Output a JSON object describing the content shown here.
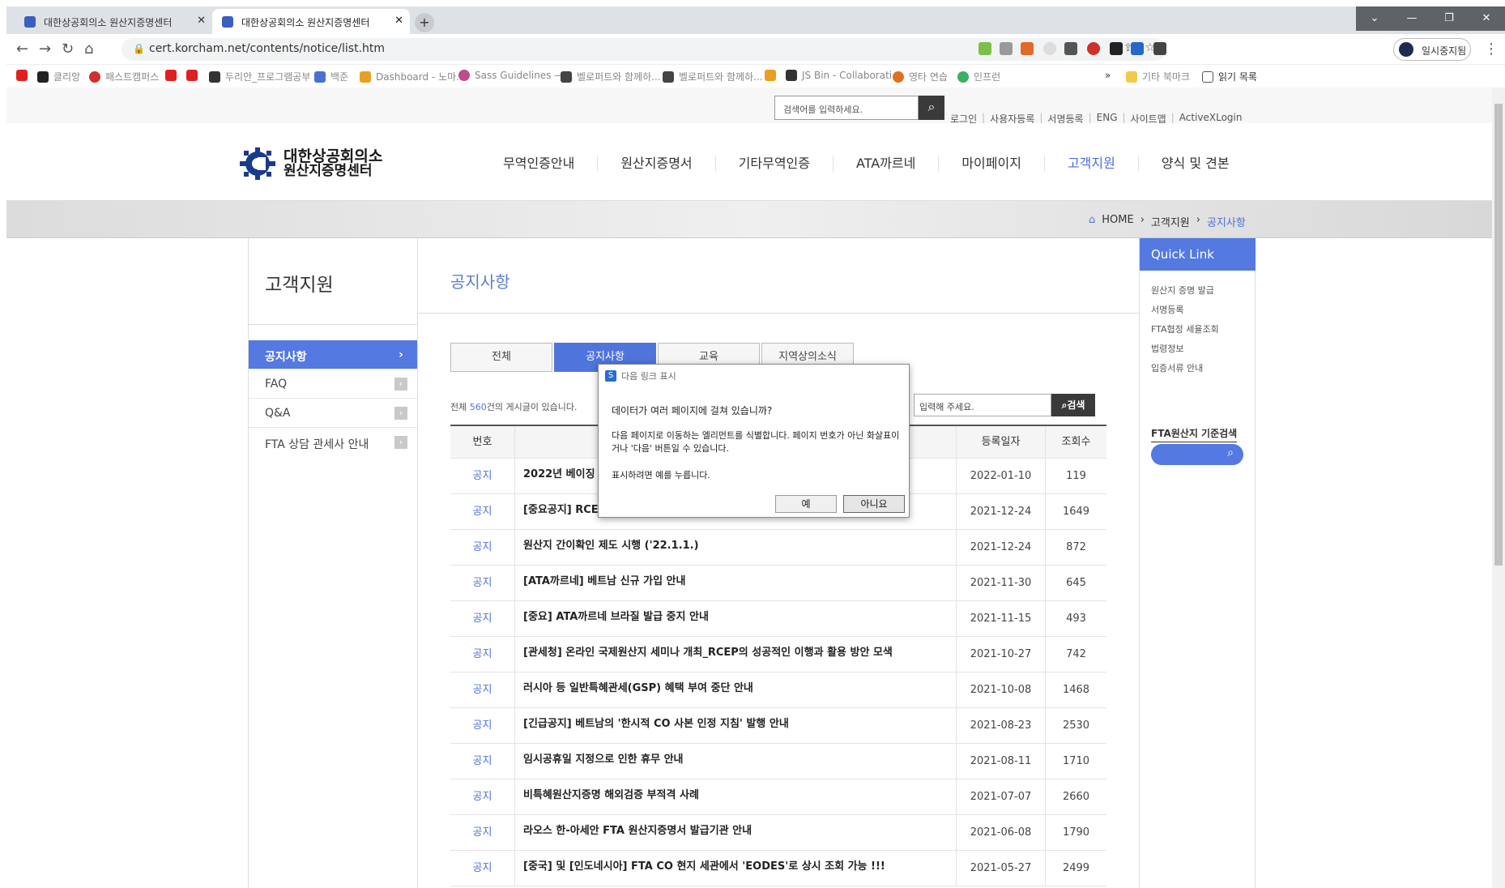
{
  "browser": {
    "tabs": [
      {
        "label": "대한상공회의소 원산지증명센터"
      },
      {
        "label": "대한상공회의소 원산지증명센터"
      }
    ],
    "url": "cert.korcham.net/contents/notice/list.htm",
    "profile_label": "일시중지됨",
    "bookmarks": [
      "클리앙",
      "패스트캠퍼스",
      "두리안_프로그램공부",
      "백준",
      "Dashboard - 노마...",
      "Sass Guidelines —...",
      "벨로퍼트와 함께하...",
      "벨로퍼트와 함께하...",
      "JS Bin - Collaborati...",
      "영타 연습",
      "인프런"
    ],
    "other_bookmarks": "기타 북마크",
    "reading_list": "읽기 목록",
    "window_buttons": [
      "⌄",
      "—",
      "❐",
      "✕"
    ]
  },
  "site": {
    "search_placeholder": "검색어를 입력하세요.",
    "util_links": [
      "로그인",
      "사용자등록",
      "서명등록",
      "ENG",
      "사이트맵",
      "ActiveXLogin"
    ],
    "logo": {
      "line1": "대한상공회의소",
      "line2": "원산지증명센터"
    },
    "gnb": [
      "무역인증안내",
      "원산지증명서",
      "기타무역인증",
      "ATA까르네",
      "마이페이지",
      "고객지원",
      "양식 및 견본"
    ],
    "breadcrumb": {
      "home": "HOME",
      "level1": "고객지원",
      "current": "공지사항"
    },
    "lnb": {
      "title": "고객지원",
      "items": [
        "공지사항",
        "FAQ",
        "Q&A",
        "FTA 상담 관세사 안내"
      ]
    },
    "content": {
      "title": "공지사항",
      "tabs": [
        "전체",
        "공지사항",
        "교육",
        "지역상의소식"
      ],
      "total_prefix": "전체 ",
      "total_count": "560",
      "total_suffix": "건의 게시글이 있습니다.",
      "search_placeholder": "입력해 주세요.",
      "search_button": "검색",
      "columns": [
        "번호",
        "",
        "등록일자",
        "조회수"
      ],
      "rows": [
        {
          "no": "공지",
          "title": "2022년 베이징 올",
          "date": "2022-01-10",
          "views": "119"
        },
        {
          "no": "공지",
          "title": "[중요공지] RCEP",
          "date": "2021-12-24",
          "views": "1649"
        },
        {
          "no": "공지",
          "title": "원산지 간이확인 제도 시행 ('22.1.1.)",
          "date": "2021-12-24",
          "views": "872"
        },
        {
          "no": "공지",
          "title": "[ATA까르네] 베트남 신규 가입 안내",
          "date": "2021-11-30",
          "views": "645"
        },
        {
          "no": "공지",
          "title": "[중요] ATA까르네 브라질 발급 중지 안내",
          "date": "2021-11-15",
          "views": "493"
        },
        {
          "no": "공지",
          "title": "[관세청] 온라인 국제원산지 세미나 개최_RCEP의 성공적인 이행과 활용 방안 모색",
          "date": "2021-10-27",
          "views": "742"
        },
        {
          "no": "공지",
          "title": "러시아 등 일반특혜관세(GSP) 혜택 부여 중단 안내",
          "date": "2021-10-08",
          "views": "1468"
        },
        {
          "no": "공지",
          "title": "[긴급공지] 베트남의 '한시적 CO 사본 인정 지침' 발행 안내",
          "date": "2021-08-23",
          "views": "2530"
        },
        {
          "no": "공지",
          "title": "임시공휴일 지정으로 인한 휴무 안내",
          "date": "2021-08-11",
          "views": "1710"
        },
        {
          "no": "공지",
          "title": "비특혜원산지증명 해외검증 부적격 사례",
          "date": "2021-07-07",
          "views": "2660"
        },
        {
          "no": "공지",
          "title": "라오스 한-아세안 FTA 원산지증명서 발급기관 안내",
          "date": "2021-06-08",
          "views": "1790"
        },
        {
          "no": "공지",
          "title": "[중국] 및 [인도네시아] FTA CO 현지 세관에서 'EODES'로 상시 조회 가능 !!!",
          "date": "2021-05-27",
          "views": "2499"
        }
      ]
    },
    "quick": {
      "title": "Quick Link",
      "links": [
        "원산지 증명 발급",
        "서명등록",
        "FTA협정 세율조회",
        "법령정보",
        "입증서류 안내"
      ],
      "fta_label": "FTA원산지 기준검색"
    }
  },
  "dialog": {
    "title": "다음 링크 표시",
    "question": "데이터가 여러 페이지에 걸쳐 있습니까?",
    "description": "다음 페이지로 이동하는 엘리먼트를 식별합니다. 페이지 번호가 아닌 화살표이거나 '다음' 버튼일 수 있습니다.",
    "hint": "표시하려면 예를 누릅니다.",
    "yes": "예",
    "no": "아니요"
  }
}
